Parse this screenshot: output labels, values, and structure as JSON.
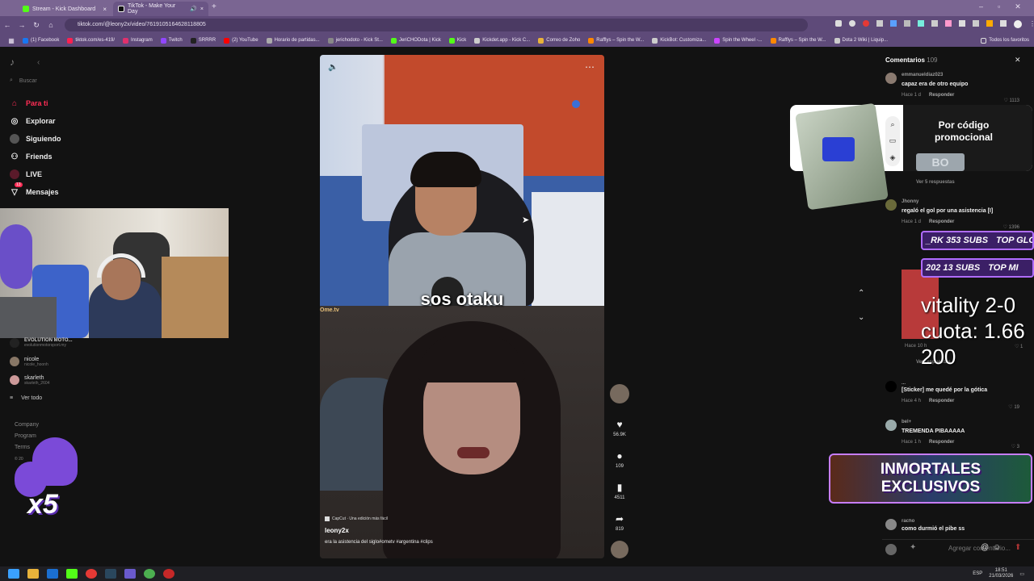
{
  "browser": {
    "tabs": [
      {
        "label": "Stream - Kick Dashboard",
        "color": "#53fc18"
      },
      {
        "label": "TikTok - Make Your Day",
        "color": "#111111"
      }
    ],
    "url": "tiktok.com/@leony2x/video/7619105164628118805",
    "bookmarks": [
      "(1) Facebook",
      "tiktok.com/es-419/",
      "Instagram",
      "Twitch",
      "SRRRR",
      "(2) YouTube",
      "Horario de partidas...",
      "jerichodoto - Kick St...",
      "JeriCHODota | Kick",
      "Kick",
      "Kickdet.app - Kick C...",
      "Correo de Zoho",
      "Rafflys – Spin the W...",
      "KickBot: Customiza...",
      "Spin the Wheel -...",
      "Rafflys – Spin the W...",
      "Dota 2 Wiki | Liquip..."
    ],
    "all_favorites": "Todos los favoritos"
  },
  "sidebar": {
    "search": "Buscar",
    "nav": [
      {
        "label": "Para ti",
        "icon": "home-icon"
      },
      {
        "label": "Explorar",
        "icon": "compass-icon"
      },
      {
        "label": "Siguiendo",
        "icon": "following-icon"
      },
      {
        "label": "Friends",
        "icon": "friends-icon"
      },
      {
        "label": "LIVE",
        "icon": "live-icon"
      },
      {
        "label": "Mensajes",
        "icon": "messages-icon",
        "badge": "13"
      }
    ],
    "following": [
      {
        "name": "EVOLUTION MOTO...",
        "handle": "evolutionmotorsport.my"
      },
      {
        "name": "nicole",
        "handle": "nicole_hoonh"
      },
      {
        "name": "skarleth",
        "handle": "skarleth_2604"
      }
    ],
    "see_all": "Ver todo",
    "footer": [
      "Company",
      "Program",
      "Terms",
      "© 20"
    ]
  },
  "video": {
    "caption": "sos otaku",
    "watermark": "Ome.tv",
    "capcut": "CapCut · Una edición más fácil",
    "author": "leony2x",
    "description": "era la asistencia del siglo#ometv #argentina #clips"
  },
  "actions": {
    "likes": "56.9K",
    "comments": "109",
    "saves": "4511",
    "shares": "819"
  },
  "comments": {
    "title": "Comentarios",
    "count": "109",
    "items": [
      {
        "user": "emmanueldiaz023",
        "text": "capaz era de otro equipo",
        "time": "Hace 1 d",
        "reply": "Responder",
        "likes": "1113"
      },
      {
        "user": "Jhonny",
        "text": "regaló el gol por una asistencia [I]",
        "time": "Hace 1 d",
        "reply": "Responder",
        "likes": "1396"
      },
      {
        "user": "...",
        "text": "[Sticker] me quedé por la gótica",
        "time": "Hace 4 h",
        "reply": "Responder",
        "likes": "19"
      },
      {
        "user": "bel+",
        "text": "TREMENDA PIBAAAAA",
        "time": "Hace 1 h",
        "reply": "Responder",
        "likes": "3"
      },
      {
        "user": "racho",
        "text": "como durmió el pibe ss",
        "time": "",
        "reply": "",
        "likes": ""
      }
    ],
    "view_replies": "Ver 5 respuestas",
    "view_replies_2": "Ver respuestas",
    "time3": "Hace 10 h",
    "likes3": "1",
    "input_placeholder": "Agregar comentario..."
  },
  "overlays": {
    "promo": {
      "title": "Por código promocional",
      "code": "BO"
    },
    "subs": [
      {
        "a": "_RK 353 SUBS",
        "b": "TOP GLOI"
      },
      {
        "a": "202 13 SUBS",
        "b": "TOP MI"
      }
    ],
    "vitality": [
      "vitality 2-0",
      "cuota: 1.66",
      "200"
    ],
    "banner": [
      "INMORTALES",
      "EXCLUSIVOS"
    ],
    "x5": "x5"
  },
  "taskbar": {
    "lang": "ESP",
    "time": "18:51",
    "date": "21/03/2026"
  }
}
